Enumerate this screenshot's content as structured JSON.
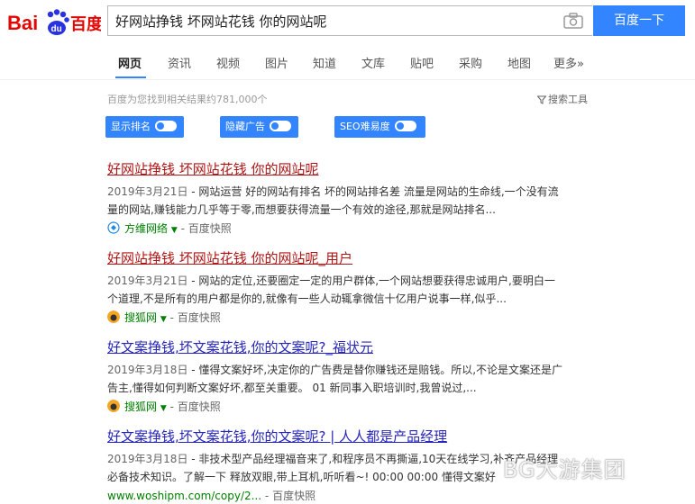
{
  "logo": {
    "text_bai": "Bai",
    "text_du": "du",
    "text_cn": "百度"
  },
  "search": {
    "query": "好网站挣钱 坏网站花钱 你的网站呢",
    "button_label": "百度一下"
  },
  "nav": {
    "items": [
      "网页",
      "资讯",
      "视频",
      "图片",
      "知道",
      "文库",
      "贴吧",
      "采购",
      "地图",
      "更多»"
    ],
    "active": "网页"
  },
  "result_count": "百度为您找到相关结果约781,000个",
  "search_tools": "搜索工具",
  "toggles": [
    {
      "label": "显示排名"
    },
    {
      "label": "隐藏广告"
    },
    {
      "label": "SEO难易度"
    }
  ],
  "results": [
    {
      "title": "好网站挣钱 坏网站花钱 你的网站呢",
      "date": "2019年3月21日",
      "abstract_line1": "网站运营 好的网站有排名 坏的网站排名差 流量是网站的生命线,一个没有流",
      "abstract_line2": "量的网站,赚钱能力几乎等于零,而想要获得流量一个有效的途径,那就是网站排名...",
      "source": "方维网络",
      "snapshot": "百度快照"
    },
    {
      "title": "好网站挣钱 坏网站花钱 你的网站呢_用户",
      "date": "2019年3月21日",
      "abstract_line1": "网站的定位,还要圈定一定的用户群体,一个网站想要获得忠诚用户,要明白一",
      "abstract_line2": "个道理,不是所有的用户都是你的,就像有一些人动辄拿微信十亿用户说事一样,似乎...",
      "source": "搜狐网",
      "snapshot": "百度快照"
    },
    {
      "title": "好文案挣钱,坏文案花钱,你的文案呢?_福状元",
      "date": "2019年3月18日",
      "abstract_line1": "懂得文案好坏,决定你的广告费是替你赚钱还是赔钱。所以,不论是文案还是广",
      "abstract_line2": "告主,懂得如何判断文案好坏,都至关重要。 01 新同事入职培训时,我曾说过,...",
      "source": "搜狐网",
      "snapshot": "百度快照"
    },
    {
      "title": "好文案挣钱,坏文案花钱,你的文案呢? | 人人都是产品经理",
      "date": "2019年3月18日",
      "abstract_line1": "非技术型产品经理福音来了,和程序员不再撕逼,10天在线学习,补齐产品经理",
      "abstract_line2": "必备技术知识。了解一下 释放双眼,带上耳机,听听看~! 00:00 00:00 懂得文案好",
      "source": "www.woshipm.com/copy/2...",
      "snapshot": "百度快照"
    }
  ],
  "watermark": "BG大游集团"
}
